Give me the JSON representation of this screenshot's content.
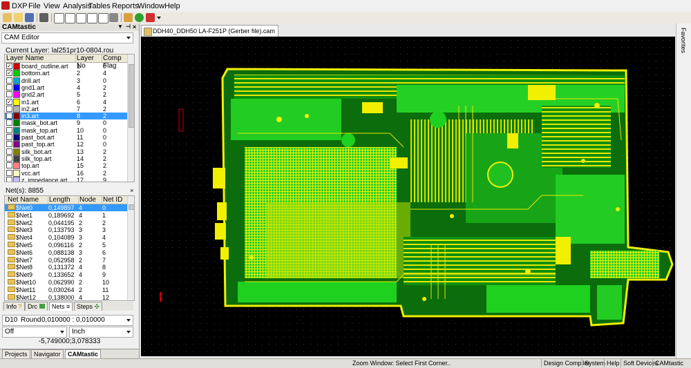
{
  "menu": [
    "DXP",
    "File",
    "View",
    "Analysis",
    "Tables",
    "Reports",
    "Window",
    "Help"
  ],
  "panel": {
    "title": "CAMtastic",
    "editor_select": "CAM Editor",
    "current_layer": "Current Layer: lal251pr10-0804.rou",
    "layer_columns": [
      "Layer Name",
      "Layer No",
      "Comp Flag"
    ],
    "layers": [
      {
        "name": "board_outline.art",
        "no": "1",
        "flag": "0",
        "checked": true,
        "color": "#cc0000"
      },
      {
        "name": "bottom.art",
        "no": "2",
        "flag": "4",
        "checked": true,
        "color": "#00cc00"
      },
      {
        "name": "drill.art",
        "no": "3",
        "flag": "0",
        "checked": false,
        "color": "#00a8c8"
      },
      {
        "name": "gnd1.art",
        "no": "4",
        "flag": "2",
        "checked": false,
        "color": "#0000ff"
      },
      {
        "name": "gnd2.art",
        "no": "5",
        "flag": "2",
        "checked": false,
        "color": "#ff00ff"
      },
      {
        "name": "in1.art",
        "no": "6",
        "flag": "4",
        "checked": true,
        "color": "#ffff00"
      },
      {
        "name": "in2.art",
        "no": "7",
        "flag": "2",
        "checked": false,
        "color": "#b0b0b0"
      },
      {
        "name": "in3.art",
        "no": "8",
        "flag": "2",
        "checked": false,
        "color": "#800000",
        "selected": true
      },
      {
        "name": "mask_bot.art",
        "no": "9",
        "flag": "0",
        "checked": false,
        "color": "#008000"
      },
      {
        "name": "mask_top.art",
        "no": "10",
        "flag": "0",
        "checked": false,
        "color": "#008080"
      },
      {
        "name": "past_bot.art",
        "no": "11",
        "flag": "0",
        "checked": false,
        "color": "#000080"
      },
      {
        "name": "past_top.art",
        "no": "12",
        "flag": "0",
        "checked": false,
        "color": "#800080"
      },
      {
        "name": "silk_bot.art",
        "no": "13",
        "flag": "2",
        "checked": false,
        "color": "#808000"
      },
      {
        "name": "silk_top.art",
        "no": "14",
        "flag": "2",
        "checked": false,
        "color": "#404040"
      },
      {
        "name": "top.art",
        "no": "15",
        "flag": "2",
        "checked": false,
        "color": "#ff8080"
      },
      {
        "name": "vcc.art",
        "no": "16",
        "flag": "2",
        "checked": false,
        "color": "#ffffc0"
      },
      {
        "name": "z_impedance.art",
        "no": "17",
        "flag": "9",
        "checked": false,
        "color": "#c0c0ff"
      }
    ],
    "nets_count": "Net(s): 8855",
    "net_columns": [
      "Net Name",
      "Length (In...",
      "Node C...",
      "Net ID"
    ],
    "nets": [
      {
        "name": "$Net0",
        "len": "0,149897",
        "nodes": "4",
        "id": "0",
        "selected": true
      },
      {
        "name": "$Net1",
        "len": "0,189692",
        "nodes": "4",
        "id": "1"
      },
      {
        "name": "$Net2",
        "len": "0,044195",
        "nodes": "2",
        "id": "2"
      },
      {
        "name": "$Net3",
        "len": "0,133793",
        "nodes": "3",
        "id": "3"
      },
      {
        "name": "$Net4",
        "len": "0,104089",
        "nodes": "3",
        "id": "4"
      },
      {
        "name": "$Net5",
        "len": "0,096116",
        "nodes": "2",
        "id": "5"
      },
      {
        "name": "$Net6",
        "len": "0,088138",
        "nodes": "3",
        "id": "6"
      },
      {
        "name": "$Net7",
        "len": "0,052958",
        "nodes": "2",
        "id": "7"
      },
      {
        "name": "$Net8",
        "len": "0,131372",
        "nodes": "4",
        "id": "8"
      },
      {
        "name": "$Net9",
        "len": "0,133652",
        "nodes": "4",
        "id": "9"
      },
      {
        "name": "$Net10",
        "len": "0,062990",
        "nodes": "2",
        "id": "10"
      },
      {
        "name": "$Net11",
        "len": "0,030264",
        "nodes": "2",
        "id": "11"
      },
      {
        "name": "$Net12",
        "len": "0,138000",
        "nodes": "4",
        "id": "12"
      }
    ],
    "tabs": [
      "Info",
      "Drc",
      "Nets",
      "Steps"
    ],
    "dcode": "D10",
    "dcode_shape": "Round",
    "dcode_size": "0,010000 : 0,010000",
    "snap": "Off",
    "units": "Inch",
    "coords": "-5,749000;3,078333",
    "bottom_tabs": [
      "Projects",
      "Navigator",
      "CAMtastic"
    ]
  },
  "document": {
    "tab_title": "DDH40_DDH50 LA-F251P (Gerber file).cam"
  },
  "right_bar": {
    "label": "Favorites"
  },
  "status": {
    "message": "Zoom Window:  Select First Corner..",
    "buttons": [
      "Design Compiler",
      "System",
      "Help",
      "Soft Devices",
      "CAMtastic"
    ]
  },
  "colors": {
    "board_green": "#1fd11f",
    "board_yellow": "#f0f000",
    "board_dark": "#0a6a0a",
    "canvas_bg": "#000000",
    "selection": "#3399ff"
  }
}
